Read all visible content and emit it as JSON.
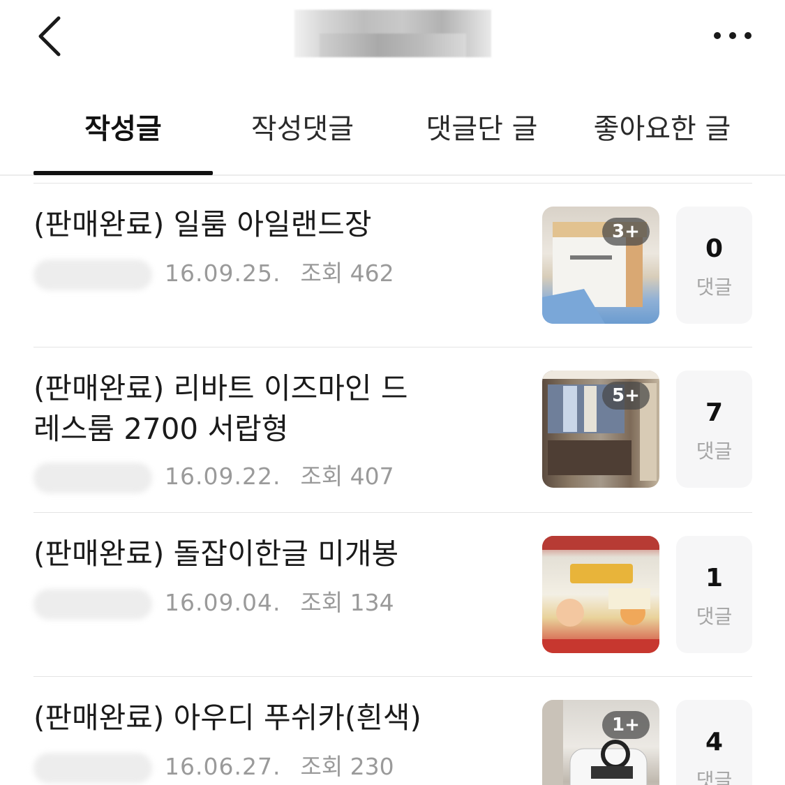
{
  "header": {
    "back_icon": "chevron-left-icon",
    "more_icon": "more-horizontal-icon"
  },
  "tabs": [
    {
      "label": "작성글",
      "active": true
    },
    {
      "label": "작성댓글",
      "active": false
    },
    {
      "label": "댓글단 글",
      "active": false
    },
    {
      "label": "좋아요한 글",
      "active": false
    }
  ],
  "posts": [
    {
      "title": "(판매완료) 일룸 아일랜드장",
      "date": "16.09.25.",
      "views": "조회 462",
      "badge": "3+",
      "comment_count": "0",
      "comment_label": "댓글"
    },
    {
      "title": "(판매완료) 리바트 이즈마인 드레스룸 2700 서랍형",
      "date": "16.09.22.",
      "views": "조회 407",
      "badge": "5+",
      "comment_count": "7",
      "comment_label": "댓글"
    },
    {
      "title": "(판매완료) 돌잡이한글 미개봉",
      "date": "16.09.04.",
      "views": "조회 134",
      "badge": "",
      "comment_count": "1",
      "comment_label": "댓글"
    },
    {
      "title": "(판매완료) 아우디 푸쉬카(흰색)",
      "date": "16.06.27.",
      "views": "조회 230",
      "badge": "1+",
      "comment_count": "4",
      "comment_label": "댓글"
    }
  ]
}
